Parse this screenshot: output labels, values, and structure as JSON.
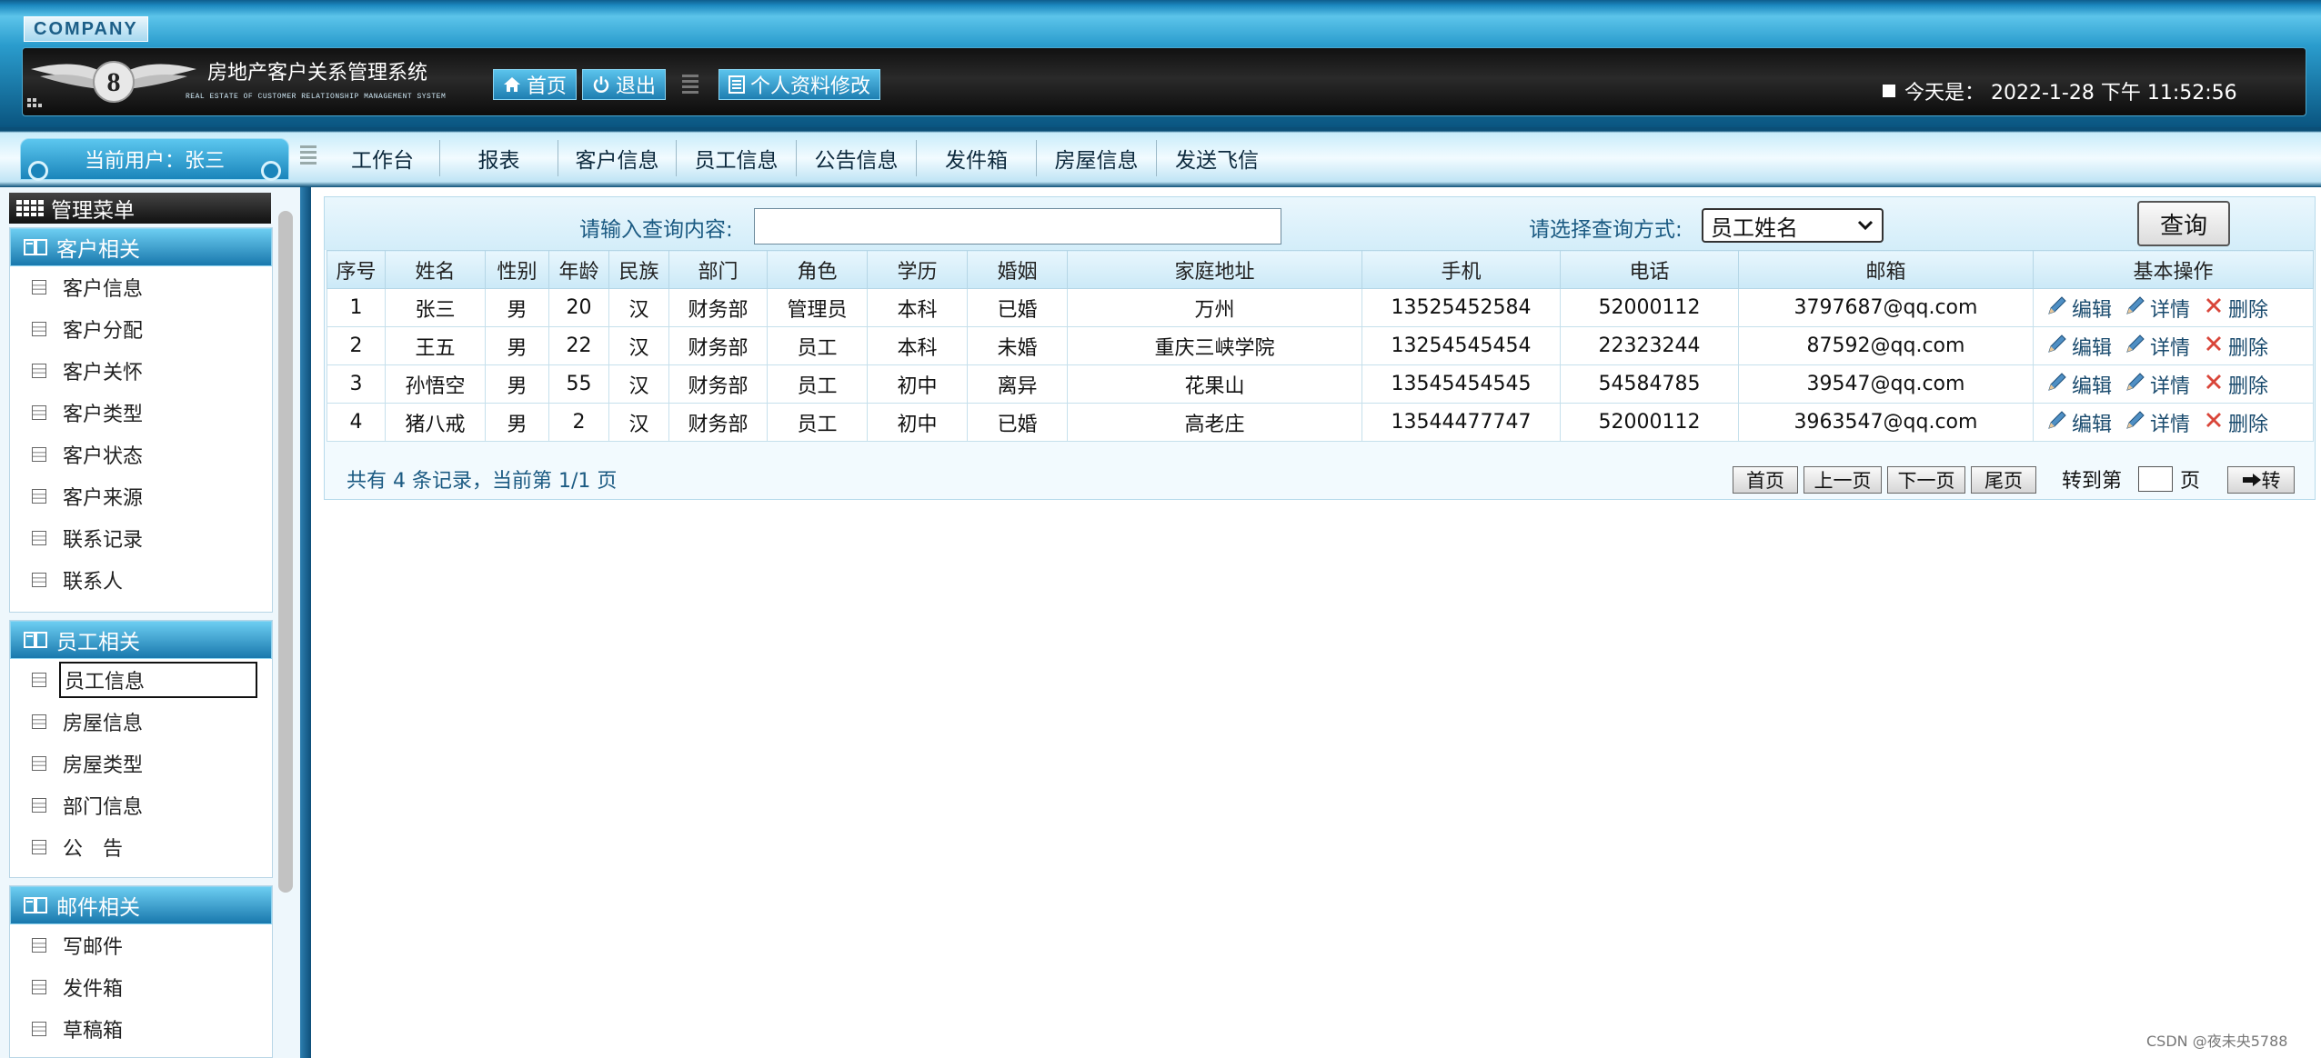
{
  "header": {
    "company": "COMPANY",
    "title": "房地产客户关系管理系统",
    "subtitle": "REAL ESTATE OF CUSTOMER RELATIONSHIP MANAGEMENT SYSTEM",
    "home_label": "首页",
    "logout_label": "退出",
    "profile_label": "个人资料修改",
    "date_text": "今天是：  2022-1-28 下午 11:52:56"
  },
  "nav": {
    "current_user": "当前用户：张三",
    "items": [
      "工作台",
      "报表",
      "客户信息",
      "员工信息",
      "公告信息",
      "发件箱",
      "房屋信息",
      "发送飞信"
    ]
  },
  "sidebar": {
    "title": "管理菜单",
    "groups": [
      {
        "name": "客户相关",
        "items": [
          "客户信息",
          "客户分配",
          "客户关怀",
          "客户类型",
          "客户状态",
          "客户来源",
          "联系记录",
          "联系人"
        ]
      },
      {
        "name": "员工相关",
        "items": [
          "员工信息",
          "房屋信息",
          "房屋类型",
          "部门信息",
          "公　告"
        ]
      },
      {
        "name": "邮件相关",
        "items": [
          "写邮件",
          "发件箱",
          "草稿箱"
        ]
      }
    ],
    "selected_item": "员工信息"
  },
  "search": {
    "query_label": "请输入查询内容:",
    "query_value": "",
    "mode_label": "请选择查询方式:",
    "mode_value": "员工姓名",
    "query_button": "查询"
  },
  "table": {
    "headers": [
      "序号",
      "姓名",
      "性别",
      "年龄",
      "民族",
      "部门",
      "角色",
      "学历",
      "婚姻",
      "家庭地址",
      "手机",
      "电话",
      "邮箱",
      "基本操作"
    ],
    "rows": [
      [
        "1",
        "张三",
        "男",
        "20",
        "汉",
        "财务部",
        "管理员",
        "本科",
        "已婚",
        "万州",
        "13525452584",
        "52000112",
        "3797687@qq.com"
      ],
      [
        "2",
        "王五",
        "男",
        "22",
        "汉",
        "财务部",
        "员工",
        "本科",
        "未婚",
        "重庆三峡学院",
        "13254545454",
        "22323244",
        "87592@qq.com"
      ],
      [
        "3",
        "孙悟空",
        "男",
        "55",
        "汉",
        "财务部",
        "员工",
        "初中",
        "离异",
        "花果山",
        "13545454545",
        "54584785",
        "39547@qq.com"
      ],
      [
        "4",
        "猪八戒",
        "男",
        "2",
        "汉",
        "财务部",
        "员工",
        "初中",
        "已婚",
        "高老庄",
        "13544477747",
        "52000112",
        "3963547@qq.com"
      ]
    ],
    "ops": {
      "edit": "编辑",
      "detail": "详情",
      "delete": "删除"
    }
  },
  "pagination": {
    "summary": "共有 4 条记录，当前第 1/1 页",
    "first": "首页",
    "prev": "上一页",
    "next": "下一页",
    "last": "尾页",
    "goto_label": "转到第",
    "goto_unit": "页",
    "go": "转"
  },
  "watermark": "CSDN @夜未央5788"
}
